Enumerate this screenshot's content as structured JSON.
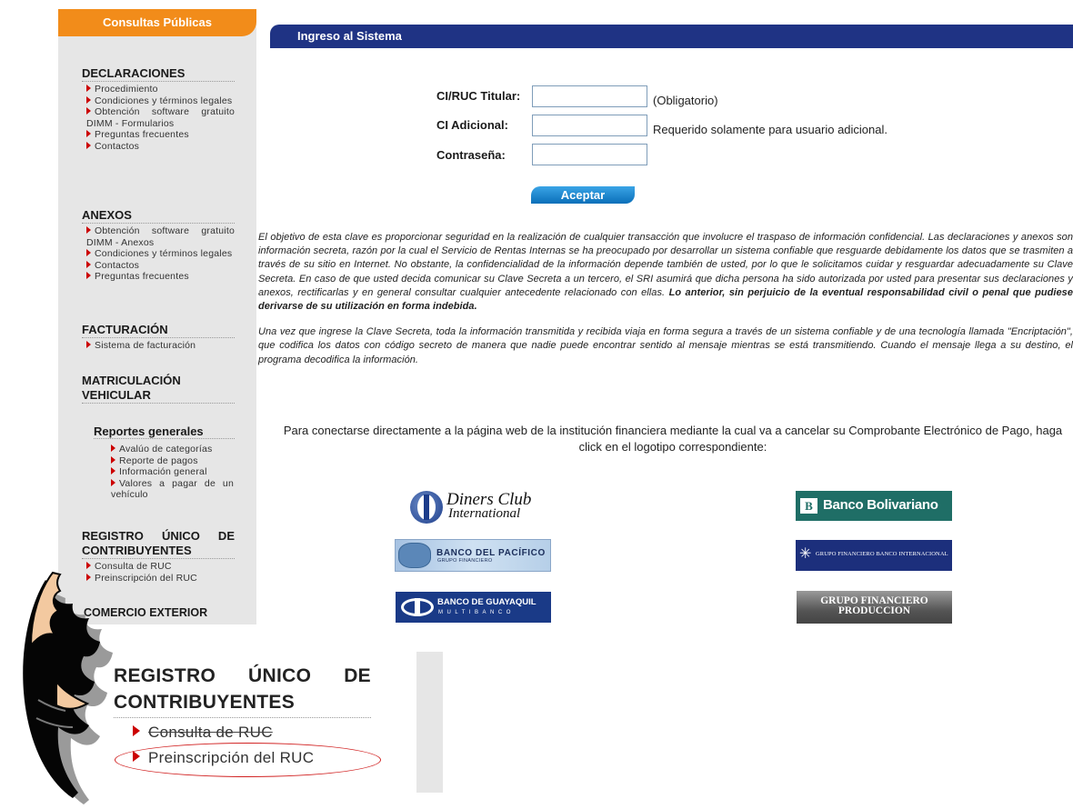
{
  "sidebar": {
    "tab_title": "Consultas Públicas",
    "sections": {
      "declaraciones": {
        "heading": "DECLARACIONES",
        "items": [
          "Procedimiento",
          "Condiciones y términos legales",
          "Obtención software gratuito DIMM - Formularios",
          "Preguntas frecuentes",
          "Contactos"
        ]
      },
      "anexos": {
        "heading": "ANEXOS",
        "items": [
          "Obtención software gratuito DIMM - Anexos",
          "Condiciones y términos legales",
          "Contactos",
          "Preguntas frecuentes"
        ]
      },
      "facturacion": {
        "heading": "FACTURACIÓN",
        "items": [
          "Sistema de facturación"
        ]
      },
      "matriculacion": {
        "heading_line1": "MATRICULACIÓN",
        "heading_line2": "VEHICULAR"
      },
      "reportes": {
        "heading": "Reportes generales",
        "items": [
          "Avalúo de categorías",
          "Reporte de pagos",
          "Información general",
          "Valores a pagar de un vehículo"
        ]
      },
      "ruc": {
        "heading_line1": "REGISTRO ÚNICO DE",
        "heading_line2": "CONTRIBUYENTES",
        "items": [
          "Consulta de RUC",
          "Preinscripción del RUC"
        ]
      },
      "comercio": {
        "heading": "COMERCIO EXTERIOR"
      }
    }
  },
  "login": {
    "title": "Ingreso al Sistema",
    "ruc_label": "CI/RUC Titular:",
    "ruc_value": "",
    "ruc_note": "(Obligatorio)",
    "adicional_label": "CI Adicional:",
    "adicional_value": "",
    "adicional_note": "Requerido solamente para usuario adicional.",
    "password_label": "Contraseña:",
    "password_value": "",
    "submit_label": "Aceptar"
  },
  "info": {
    "paragraph1": "El objetivo de esta clave es proporcionar seguridad en la realización de cualquier transacción que involucre el traspaso de información confidencial. Las declaraciones y anexos son información secreta, razón por la cual el Servicio de Rentas Internas se ha preocupado por desarrollar un sistema confiable que resguarde debidamente los datos que se trasmiten a través de su sitio en Internet. No obstante, la confidencialidad de la información depende también de usted, por lo que le solicitamos cuidar y resguardar adecuadamente su Clave Secreta. En caso de que usted decida comunicar su Clave Secreta a un tercero, el SRI asumirá que dicha persona ha sido autorizada por usted para presentar sus declaraciones y anexos, rectificarlas y en general consultar cualquier antecedente relacionado con ellas.",
    "paragraph1_bold": "Lo anterior, sin perjuicio de la eventual responsabilidad civil o penal que pudiese derivarse de su utilización en forma indebida.",
    "paragraph2": "Una vez que ingrese la Clave Secreta, toda la información transmitida y recibida viaja en forma segura a través de un sistema confiable y de una tecnología llamada \"Encriptación\", que codifica los datos con código secreto de manera que nadie puede encontrar sentido al mensaje mientras se está transmitiendo. Cuando el mensaje llega a su destino, el programa decodifica la información."
  },
  "banks": {
    "intro": "Para conectarse directamente a la página web de la institución financiera mediante la cual va a cancelar su Comprobante Electrónico de Pago, haga click en el logotipo correspondiente:",
    "diners_line1": "Diners Club",
    "diners_line2": "International",
    "bolivariano_mark": "B",
    "bolivariano": "Banco Bolivariano",
    "pacifico_line1": "BANCO DEL PACÍFICO",
    "pacifico_line2": "GRUPO FINANCIERO",
    "internacional": "GRUPO FINANCIERO BANCO INTERNACIONAL",
    "guayaquil_line1": "BANCO DE GUAYAQUIL",
    "guayaquil_line2": "MULTIBANCO",
    "produccion_line1": "GRUPO FINANCIERO",
    "produccion_line2": "PRODUCCION"
  },
  "zoom": {
    "heading_line1": "REGISTRO ÚNICO DE",
    "heading_line2": "CONTRIBUYENTES",
    "item1": "Consulta de RUC",
    "item2": "Preinscripción del RUC"
  },
  "colors": {
    "tab_orange": "#f28c1a",
    "header_blue": "#1f3384",
    "sidebar_gray": "#e6e6e6",
    "bullet_red": "#cc0000",
    "highlight_red": "#d12222",
    "button_blue": "#0a6fb9"
  }
}
